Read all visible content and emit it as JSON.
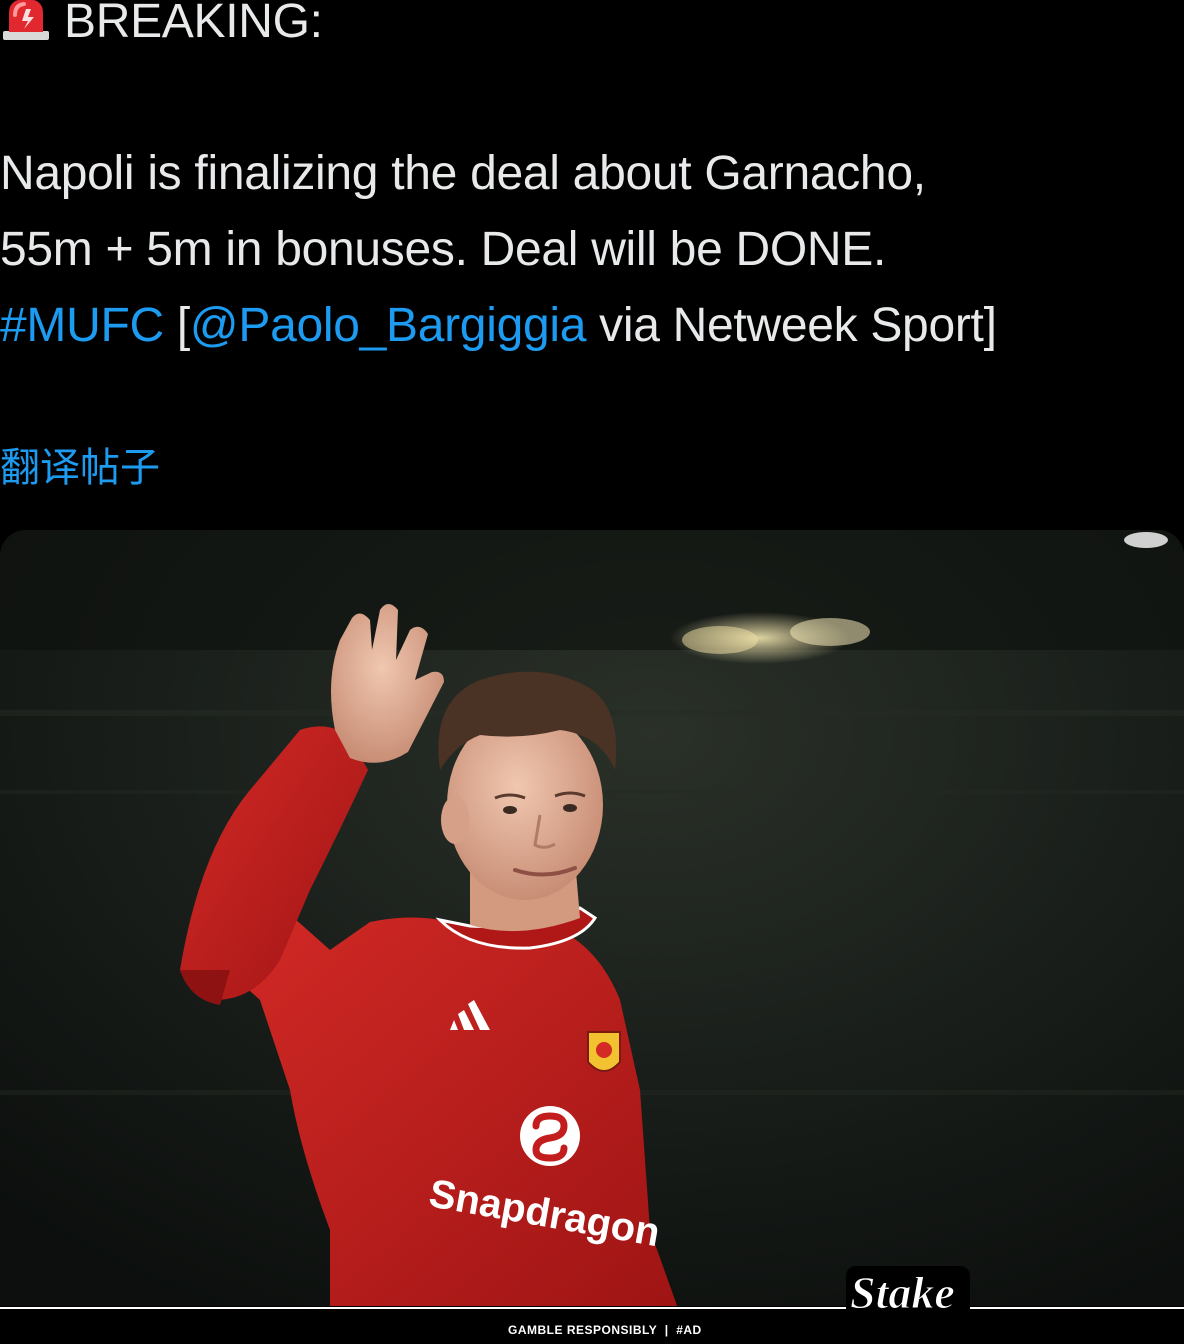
{
  "tweet": {
    "breaking_label": "BREAKING:",
    "line1": "Napoli is finalizing the deal about Garnacho,",
    "line2": "55m + 5m in bonuses. Deal will be DONE.",
    "hashtag": "#MUFC",
    "bracket_open": " [",
    "mention": "@Paolo_Bargiggia",
    "source_text": " via Netweek Sport]"
  },
  "translate_link": "翻译帖子",
  "media": {
    "icons": [
      "siren-icon",
      "adidas-logo-icon",
      "club-crest-icon",
      "snapdragon-logo-icon"
    ],
    "sponsor_shirt_text": "Snapdragon",
    "brand_logo": "Stake",
    "footer_text": "GAMBLE RESPONSIBLY  |  #AD"
  },
  "colors": {
    "background": "#000000",
    "text": "#e7e9ea",
    "link": "#1d9bf0",
    "shirt_red": "#c41d1d"
  }
}
